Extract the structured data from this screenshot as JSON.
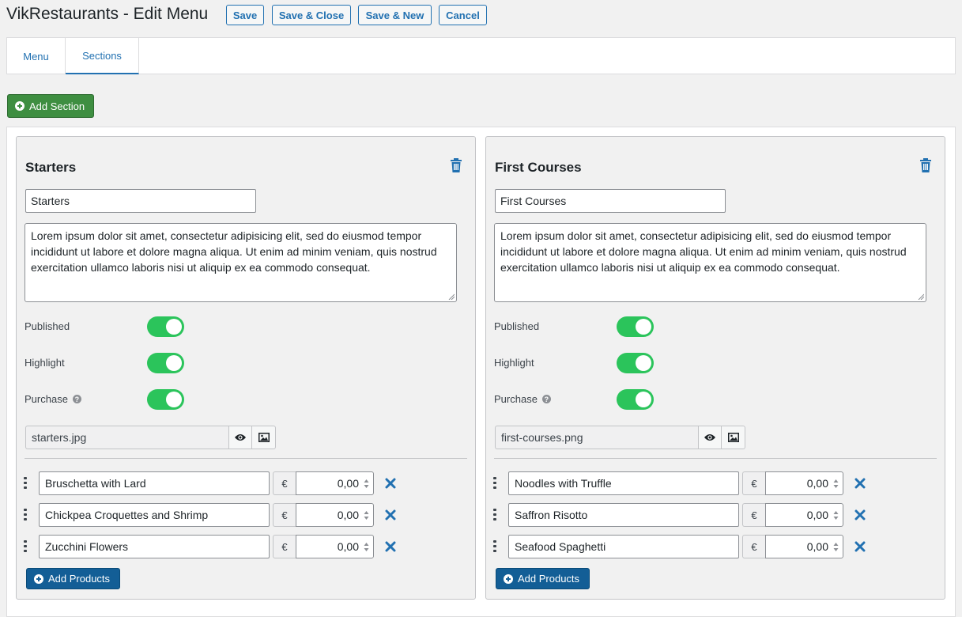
{
  "header": {
    "title": "VikRestaurants - Edit Menu",
    "buttons": {
      "save": "Save",
      "save_close": "Save & Close",
      "save_new": "Save & New",
      "cancel": "Cancel"
    }
  },
  "tabs": {
    "menu": "Menu",
    "sections": "Sections"
  },
  "add_section_label": "Add Section",
  "colors": {
    "accent": "#2271b1",
    "toggle_on": "#2bc45b",
    "add_section": "#3e8e41",
    "add_products": "#135e96"
  },
  "sections": [
    {
      "title": "Starters",
      "name_value": "Starters",
      "description": "Lorem ipsum dolor sit amet, consectetur adipisicing elit, sed do eiusmod tempor incididunt ut labore et dolore magna aliqua. Ut enim ad minim veniam, quis nostrud exercitation ullamco laboris nisi ut aliquip ex ea commodo consequat.",
      "toggles": [
        {
          "label": "Published",
          "on": true
        },
        {
          "label": "Highlight",
          "on": true
        },
        {
          "label": "Purchase",
          "on": true
        }
      ],
      "image": "starters.jpg",
      "products": [
        {
          "name": "Bruschetta with Lard",
          "currency": "€",
          "price": "0,00"
        },
        {
          "name": "Chickpea Croquettes and Shrimp",
          "currency": "€",
          "price": "0,00"
        },
        {
          "name": "Zucchini Flowers",
          "currency": "€",
          "price": "0,00"
        }
      ],
      "add_products_label": "Add Products"
    },
    {
      "title": "First Courses",
      "name_value": "First Courses",
      "description": "Lorem ipsum dolor sit amet, consectetur adipisicing elit, sed do eiusmod tempor incididunt ut labore et dolore magna aliqua. Ut enim ad minim veniam, quis nostrud exercitation ullamco laboris nisi ut aliquip ex ea commodo consequat.",
      "toggles": [
        {
          "label": "Published",
          "on": true
        },
        {
          "label": "Highlight",
          "on": true
        },
        {
          "label": "Purchase",
          "on": true
        }
      ],
      "image": "first-courses.png",
      "products": [
        {
          "name": "Noodles with Truffle",
          "currency": "€",
          "price": "0,00"
        },
        {
          "name": "Saffron Risotto",
          "currency": "€",
          "price": "0,00"
        },
        {
          "name": "Seafood Spaghetti",
          "currency": "€",
          "price": "0,00"
        }
      ],
      "add_products_label": "Add Products"
    }
  ]
}
